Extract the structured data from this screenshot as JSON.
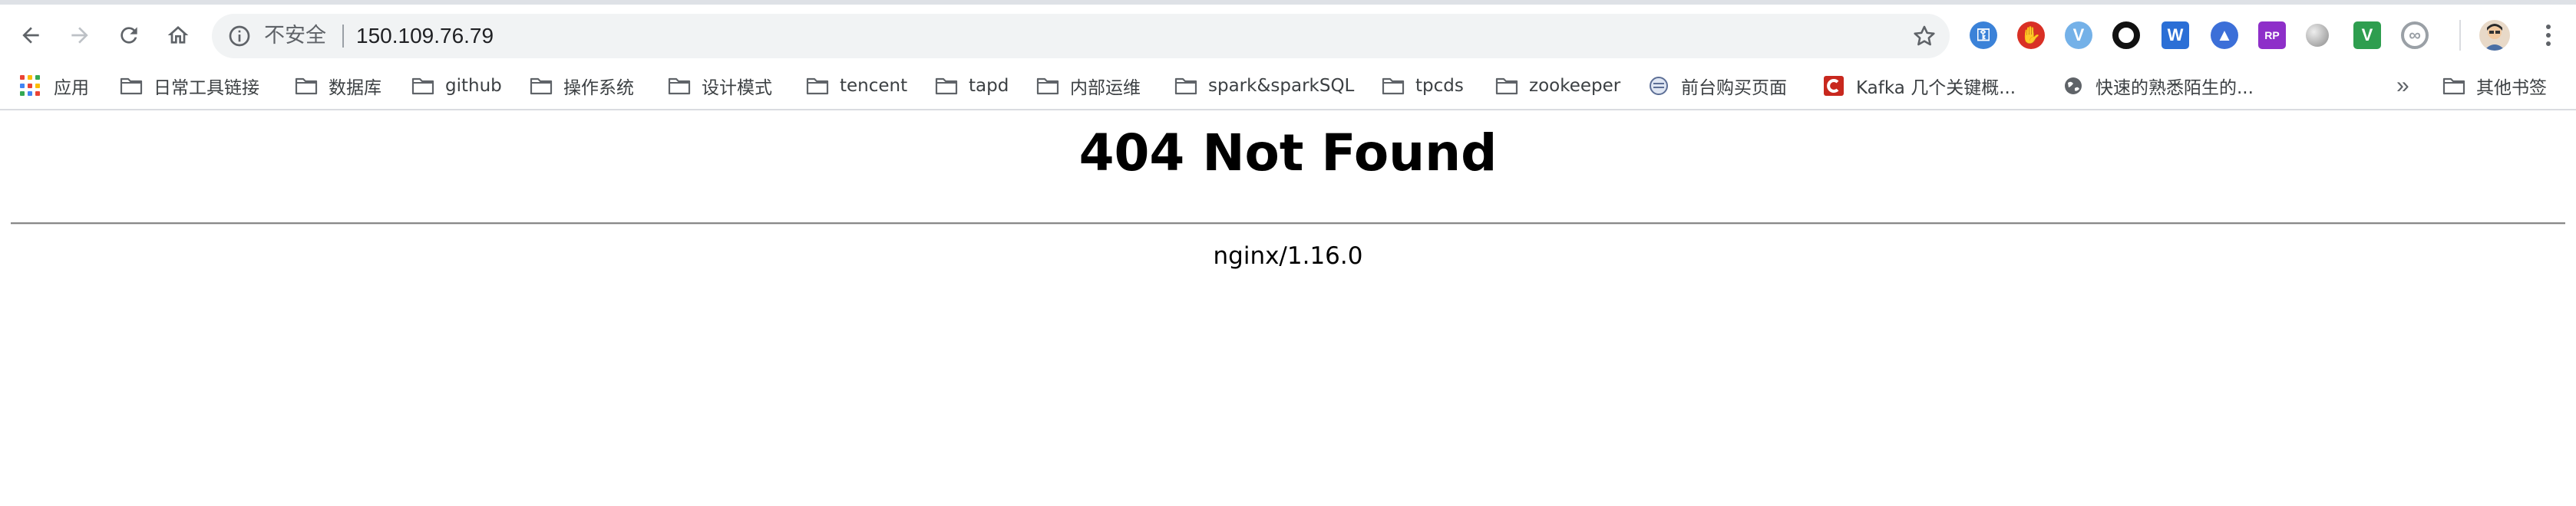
{
  "browser": {
    "security_label": "不安全",
    "url": "150.109.76.79",
    "icons": {
      "back": "back-arrow-icon",
      "forward": "forward-arrow-icon",
      "reload": "reload-icon",
      "home": "home-icon",
      "info": "info-icon",
      "bookmark_star": "star-icon",
      "menu": "kebab-menu-icon"
    },
    "extensions": [
      {
        "name": "1password-icon",
        "color": "#3b82d8"
      },
      {
        "name": "adblock-icon",
        "color": "#d93025"
      },
      {
        "name": "vimium-icon",
        "color": "#74b1e8"
      },
      {
        "name": "circle-extension-icon",
        "color": "#111111"
      },
      {
        "name": "word-icon",
        "color": "#2b6fd6"
      },
      {
        "name": "graduation-cap-icon",
        "color": "#3c6fd8"
      },
      {
        "name": "axure-rp-icon",
        "color": "#8e2fc9"
      },
      {
        "name": "gray-orb-icon",
        "color": "#8a8a8a"
      },
      {
        "name": "v-extension-icon",
        "color": "#2e9e4f"
      },
      {
        "name": "link-extension-icon",
        "color": "#9aa0a6"
      }
    ]
  },
  "bookmarks": {
    "items": [
      {
        "label": "应用",
        "icon": "apps-grid-icon"
      },
      {
        "label": "日常工具链接",
        "icon": "folder-icon"
      },
      {
        "label": "数据库",
        "icon": "folder-icon"
      },
      {
        "label": "github",
        "icon": "folder-icon"
      },
      {
        "label": "操作系统",
        "icon": "folder-icon"
      },
      {
        "label": "设计模式",
        "icon": "folder-icon"
      },
      {
        "label": "tencent",
        "icon": "folder-icon"
      },
      {
        "label": "tapd",
        "icon": "folder-icon"
      },
      {
        "label": "内部运维",
        "icon": "folder-icon"
      },
      {
        "label": "spark&sparkSQL",
        "icon": "folder-icon"
      },
      {
        "label": "tpcds",
        "icon": "folder-icon"
      },
      {
        "label": "zookeeper",
        "icon": "folder-icon"
      },
      {
        "label": "前台购买页面",
        "icon": "page-favicon-icon"
      },
      {
        "label": "Kafka 几个关键概...",
        "icon": "csdn-icon"
      },
      {
        "label": "快速的熟悉陌生的...",
        "icon": "globe-icon"
      }
    ],
    "overflow": "»",
    "other": {
      "label": "其他书签",
      "icon": "folder-icon"
    }
  },
  "page": {
    "title": "404 Not Found",
    "server": "nginx/1.16.0"
  }
}
